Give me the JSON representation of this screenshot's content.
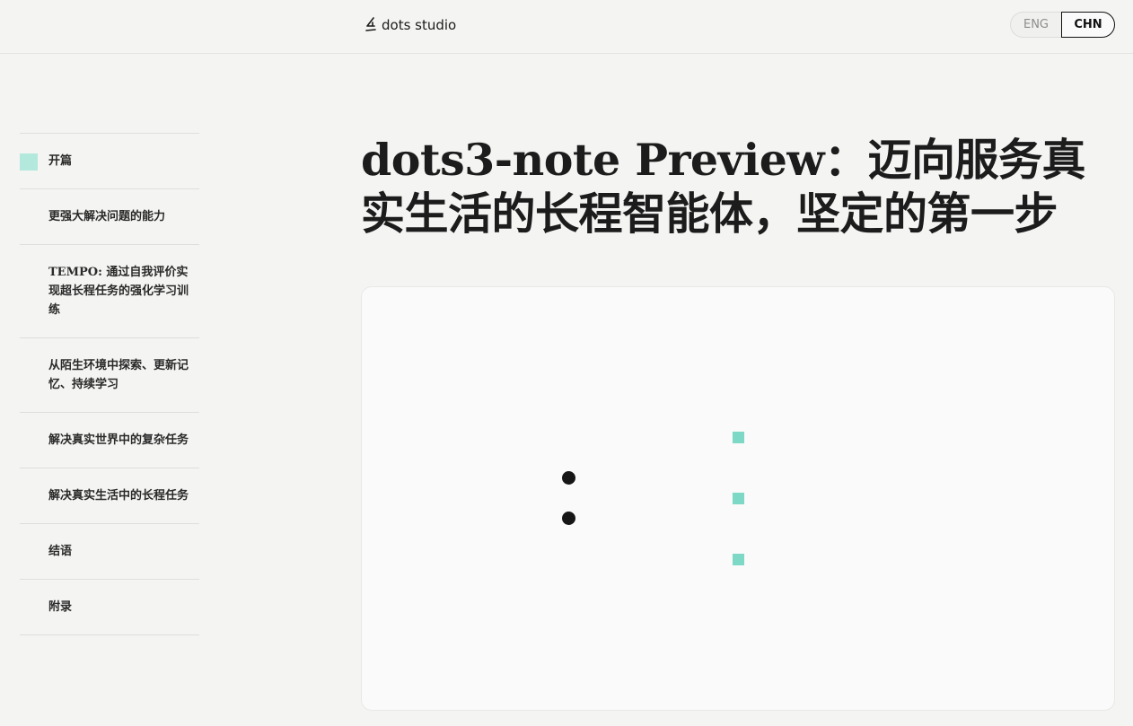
{
  "header": {
    "brand": "dots studio",
    "brand_icon": "dots-logo-icon",
    "lang": {
      "eng": "ENG",
      "chn": "CHN",
      "active": "CHN"
    }
  },
  "toc": {
    "items": [
      {
        "label": "开篇",
        "active": true
      },
      {
        "label": "更强大解决问题的能力"
      },
      {
        "label": "TEMPO: 通过自我评价实现超长程任务的强化学习训练"
      },
      {
        "label": "从陌生环境中探索、更新记忆、持续学习"
      },
      {
        "label": "解决真实世界中的复杂任务"
      },
      {
        "label": "解决真实生活中的长程任务"
      },
      {
        "label": "结语"
      },
      {
        "label": "附录"
      }
    ],
    "active_color": "#b3e8dc"
  },
  "main": {
    "title": "dots3-note Preview：迈向服务真实生活的长程智能体，坚定的第一步"
  },
  "colors": {
    "accent": "#7dd8c6",
    "dot": "#161616",
    "background": "#f4f4f2"
  }
}
